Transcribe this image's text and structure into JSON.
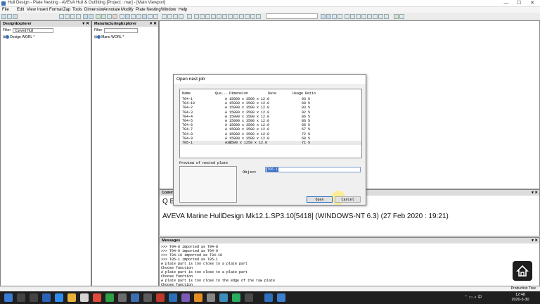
{
  "window": {
    "title": "Hull Design - Plate Nesting - AVEVA Hull & Outfitting [Project : mar] - [Main Viewport]",
    "controls": [
      "—",
      "☐",
      "✕"
    ]
  },
  "menu": [
    "File",
    "Edit",
    "View",
    "Insert",
    "Format",
    "Zap",
    "Tools",
    "Dimension",
    "Annotate",
    "Modify",
    "Plate Nesting",
    "Window",
    "Help"
  ],
  "design_explorer": {
    "title": "DesignExplorer",
    "filter_label": "Filter",
    "filter_value": "Curved Hull",
    "root_item": "Design WORL *"
  },
  "manufacturing_explorer": {
    "title": "ManufacturingExplorer",
    "filter_label": "Filter",
    "filter_value": "",
    "root_item": "Manu WORL *"
  },
  "dialog": {
    "title": "Open nest job",
    "columns": [
      "Name",
      "Qua...",
      "Dimension",
      "Date",
      "Usage Ratio"
    ],
    "rows": [
      {
        "name": "T04-1",
        "qua": "A",
        "dim": "15000 x 3500 x 12.0",
        "date": "",
        "usage": "93 %"
      },
      {
        "name": "T04-10",
        "qua": "A",
        "dim": "15000 x 3500 x 12.0",
        "date": "",
        "usage": "68 %"
      },
      {
        "name": "T04-2",
        "qua": "A",
        "dim": "15000 x 3500 x 12.0",
        "date": "",
        "usage": "93 %"
      },
      {
        "name": "T04-3",
        "qua": "A",
        "dim": "15000 x 3500 x 12.0",
        "date": "",
        "usage": "92 %"
      },
      {
        "name": "T04-4",
        "qua": "A",
        "dim": "15000 x 3500 x 12.0",
        "date": "",
        "usage": "86 %"
      },
      {
        "name": "T04-5",
        "qua": "A",
        "dim": "15000 x 3500 x 12.0",
        "date": "",
        "usage": "86 %"
      },
      {
        "name": "T04-6",
        "qua": "A",
        "dim": "15000 x 3500 x 12.0",
        "date": "",
        "usage": "66 %"
      },
      {
        "name": "T04-7",
        "qua": "A",
        "dim": "15000 x 3500 x 12.0",
        "date": "",
        "usage": "67 %"
      },
      {
        "name": "T04-8",
        "qua": "A",
        "dim": "15000 x 3500 x 12.0",
        "date": "",
        "usage": "72 %"
      },
      {
        "name": "T04-9",
        "qua": "A",
        "dim": "15000 x 3500 x 12.0",
        "date": "",
        "usage": "68 %"
      },
      {
        "name": "T05-1",
        "qua": "A36",
        "dim": "2500 x 1250 x 12.0",
        "date": "",
        "usage": "71 %"
      }
    ],
    "preview_label": "Preview of nested plate",
    "object_label": "Object",
    "object_value": "T05-1",
    "open_button": "Open",
    "cancel_button": "Cancel"
  },
  "command": {
    "title": "Command Window",
    "line1": "Q B",
    "line2": "AVEVA Marine HullDesign Mk12.1.SP3.10[5418]  (WINDOWS-NT 6.3)  (27 Feb 2020 : 19:21)"
  },
  "messages": {
    "title": "Messages",
    "lines": [
      ">>> T04-8 imported as T04-8",
      ">>> T04-9 imported as T04-9",
      ">>> T04-10 imported as T04-10",
      ">>> T05-1 imported as T05-1",
      "A plate part is too close to a plate part",
      "Choose function",
      "A plate part is too close to a plate part",
      "Choose function",
      "A plate part is too close to the edge of the raw plate",
      "Choose function"
    ]
  },
  "status": {
    "label": "Production Tree"
  },
  "taskbar": {
    "time": "12:48",
    "date": "2020-3-30"
  },
  "colors": {
    "selection": "#3b6fc4",
    "taskbar": "#1f1f1f",
    "cursor_highlight": "#ffec78"
  }
}
